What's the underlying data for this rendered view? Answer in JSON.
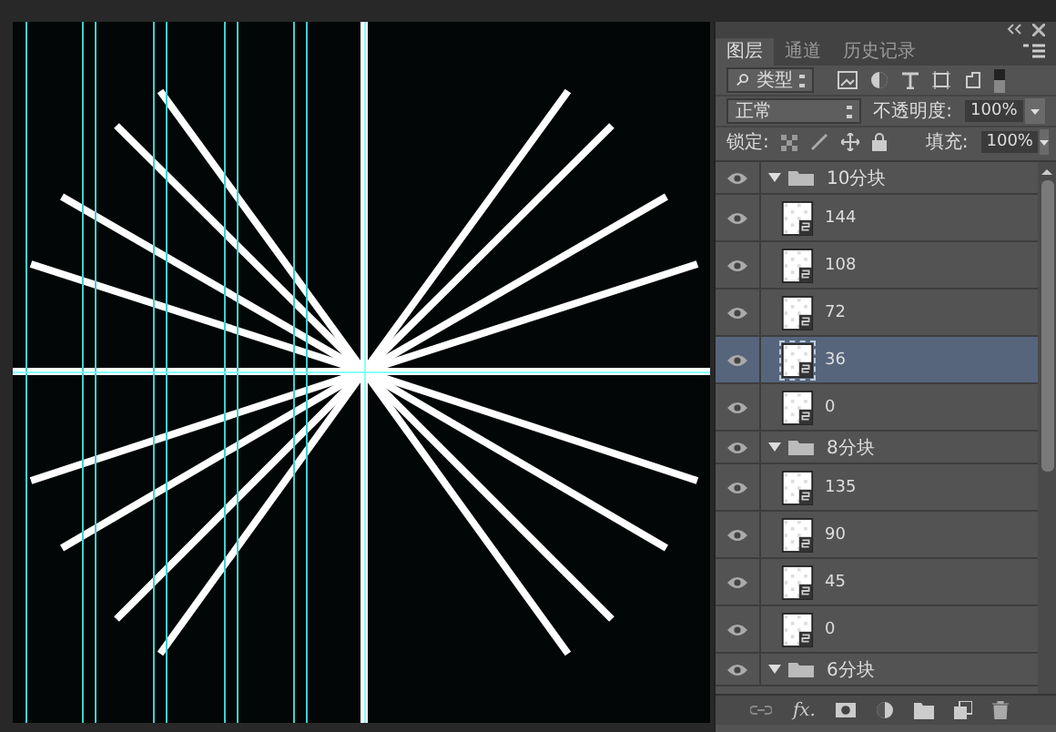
{
  "panel": {
    "tabs": [
      {
        "label": "图层",
        "selected": true
      },
      {
        "label": "通道",
        "selected": false
      },
      {
        "label": "历史记录",
        "selected": false
      }
    ],
    "filter": {
      "value": "类型"
    },
    "blend_mode": {
      "value": "正常"
    },
    "opacity": {
      "label": "不透明度:",
      "value": "100%"
    },
    "lock": {
      "label": "锁定:"
    },
    "fill": {
      "label": "填充:",
      "value": "100%"
    },
    "effects_button": {
      "label": "fx."
    },
    "layers": [
      {
        "name": "10分块",
        "kind": "group",
        "expanded": true,
        "visible": true,
        "selected": false,
        "children": [
          {
            "name": "144",
            "kind": "layer",
            "visible": true,
            "selected": false
          },
          {
            "name": "108",
            "kind": "layer",
            "visible": true,
            "selected": false
          },
          {
            "name": "72",
            "kind": "layer",
            "visible": true,
            "selected": false
          },
          {
            "name": "36",
            "kind": "layer",
            "visible": true,
            "selected": true
          },
          {
            "name": "0",
            "kind": "layer",
            "visible": true,
            "selected": false
          }
        ]
      },
      {
        "name": "8分块",
        "kind": "group",
        "expanded": true,
        "visible": true,
        "selected": false,
        "children": [
          {
            "name": "135",
            "kind": "layer",
            "visible": true,
            "selected": false
          },
          {
            "name": "90",
            "kind": "layer",
            "visible": true,
            "selected": false
          },
          {
            "name": "45",
            "kind": "layer",
            "visible": true,
            "selected": false
          },
          {
            "name": "0",
            "kind": "layer",
            "visible": true,
            "selected": false
          }
        ]
      },
      {
        "name": "6分块",
        "kind": "group",
        "expanded": true,
        "visible": true,
        "selected": false
      }
    ]
  }
}
